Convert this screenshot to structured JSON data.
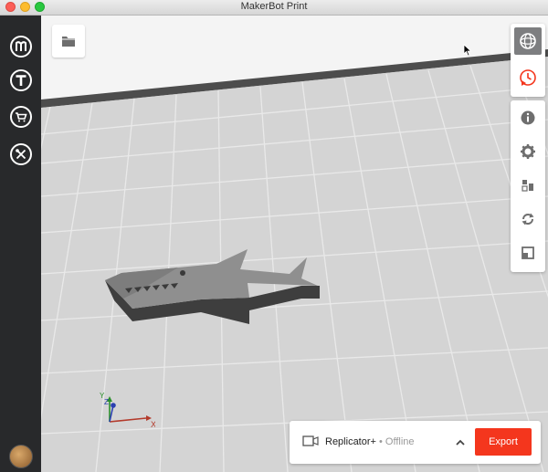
{
  "window": {
    "title": "MakerBot Print"
  },
  "sidebar": {
    "items": [
      {
        "icon": "makerbot-logo-icon"
      },
      {
        "icon": "thingiverse-icon"
      },
      {
        "icon": "cart-icon"
      },
      {
        "icon": "tools-icon"
      }
    ],
    "avatar": "user-avatar"
  },
  "viewport": {
    "object": "shark model",
    "axes": {
      "x": "X",
      "y": "Y",
      "z": "Z"
    }
  },
  "toolbar_top": [
    {
      "icon": "view-sphere-icon",
      "active": true
    },
    {
      "icon": "print-preview-icon",
      "active": false
    }
  ],
  "toolbar_bottom": [
    {
      "icon": "info-icon"
    },
    {
      "icon": "settings-gear-icon"
    },
    {
      "icon": "arrange-icon"
    },
    {
      "icon": "rotate-icon"
    },
    {
      "icon": "scale-icon"
    }
  ],
  "printer": {
    "name": "Replicator+",
    "status": " • Offline",
    "export_label": "Export"
  },
  "colors": {
    "accent": "#f4361d",
    "sidebar": "#28292b",
    "grid_bg": "#d3d3d3"
  }
}
